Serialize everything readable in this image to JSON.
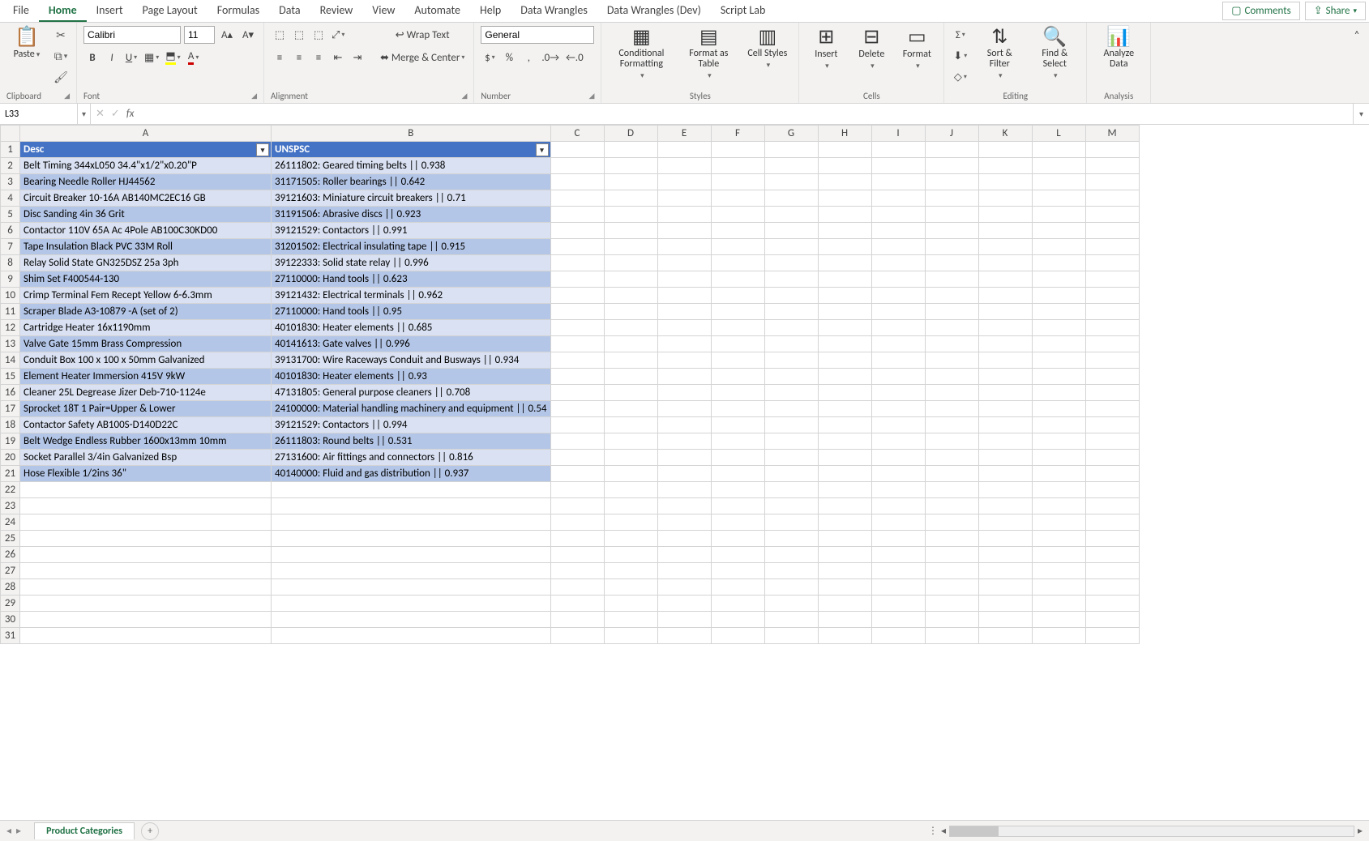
{
  "tabs": [
    "File",
    "Home",
    "Insert",
    "Page Layout",
    "Formulas",
    "Data",
    "Review",
    "View",
    "Automate",
    "Help",
    "Data Wrangles",
    "Data Wrangles (Dev)",
    "Script Lab"
  ],
  "active_tab": "Home",
  "actions": {
    "comments": "Comments",
    "share": "Share"
  },
  "clipboard": {
    "paste": "Paste",
    "group": "Clipboard"
  },
  "font": {
    "name": "Calibri",
    "size": "11",
    "group": "Font"
  },
  "alignment": {
    "wrap": "Wrap Text",
    "merge": "Merge & Center",
    "group": "Alignment"
  },
  "number": {
    "format": "General",
    "group": "Number"
  },
  "styles": {
    "cond": "Conditional Formatting",
    "table": "Format as Table",
    "cell": "Cell Styles",
    "group": "Styles"
  },
  "cells": {
    "insert": "Insert",
    "delete": "Delete",
    "format": "Format",
    "group": "Cells"
  },
  "editing": {
    "sort": "Sort & Filter",
    "find": "Find & Select",
    "group": "Editing"
  },
  "analysis": {
    "analyze": "Analyze Data",
    "group": "Analysis"
  },
  "name_box": "L33",
  "formula": "",
  "columns": [
    "A",
    "B",
    "C",
    "D",
    "E",
    "F",
    "G",
    "H",
    "I",
    "J",
    "K",
    "L",
    "M"
  ],
  "headers": {
    "A": "Desc",
    "B": "UNSPSC"
  },
  "rows": [
    {
      "n": 2,
      "a": "Belt Timing 344xL050 34.4\"x1/2\"x0.20\"P",
      "b": "26111802: Geared timing belts || 0.938"
    },
    {
      "n": 3,
      "a": "Bearing Needle Roller HJ44562",
      "b": "31171505: Roller bearings || 0.642"
    },
    {
      "n": 4,
      "a": "Circuit Breaker 10-16A AB140MC2EC16 GB",
      "b": "39121603: Miniature circuit breakers || 0.71"
    },
    {
      "n": 5,
      "a": "Disc Sanding 4in 36 Grit",
      "b": "31191506: Abrasive discs || 0.923"
    },
    {
      "n": 6,
      "a": "Contactor 110V 65A Ac 4Pole AB100C30KD00",
      "b": "39121529: Contactors || 0.991"
    },
    {
      "n": 7,
      "a": "Tape Insulation Black PVC 33M Roll",
      "b": "31201502: Electrical insulating tape || 0.915"
    },
    {
      "n": 8,
      "a": "Relay Solid State GN325DSZ 25a 3ph",
      "b": "39122333: Solid state relay || 0.996"
    },
    {
      "n": 9,
      "a": "Shim Set F400544-130",
      "b": "27110000: Hand tools || 0.623"
    },
    {
      "n": 10,
      "a": "Crimp Terminal Fem Recept Yellow 6-6.3mm",
      "b": "39121432: Electrical terminals || 0.962"
    },
    {
      "n": 11,
      "a": "Scraper Blade A3-10879 -A (set of 2)",
      "b": "27110000: Hand tools || 0.95"
    },
    {
      "n": 12,
      "a": "Cartridge Heater 16x1190mm",
      "b": "40101830: Heater elements || 0.685"
    },
    {
      "n": 13,
      "a": "Valve Gate 15mm Brass Compression",
      "b": "40141613: Gate valves || 0.996"
    },
    {
      "n": 14,
      "a": "Conduit Box 100 x 100 x 50mm Galvanized",
      "b": "39131700: Wire Raceways Conduit and Busways || 0.934"
    },
    {
      "n": 15,
      "a": "Element Heater Immersion 415V 9kW",
      "b": "40101830: Heater elements || 0.93"
    },
    {
      "n": 16,
      "a": "Cleaner 25L Degrease Jizer Deb-710-1124e",
      "b": "47131805: General purpose cleaners || 0.708"
    },
    {
      "n": 17,
      "a": "Sprocket 18T 1 Pair=Upper & Lower",
      "b": "24100000: Material handling machinery and equipment || 0.54"
    },
    {
      "n": 18,
      "a": "Contactor Safety AB100S-D140D22C",
      "b": "39121529: Contactors || 0.994"
    },
    {
      "n": 19,
      "a": "Belt Wedge Endless Rubber 1600x13mm 10mm",
      "b": "26111803: Round belts || 0.531"
    },
    {
      "n": 20,
      "a": "Socket Parallel 3/4in Galvanized Bsp",
      "b": "27131600: Air fittings and connectors || 0.816"
    },
    {
      "n": 21,
      "a": "Hose Flexible 1/2ins 36\"",
      "b": "40140000: Fluid and gas distribution || 0.937"
    }
  ],
  "empty_rows": [
    22,
    23,
    24,
    25,
    26,
    27,
    28,
    29,
    30,
    31
  ],
  "sheet_tab": "Product Categories"
}
